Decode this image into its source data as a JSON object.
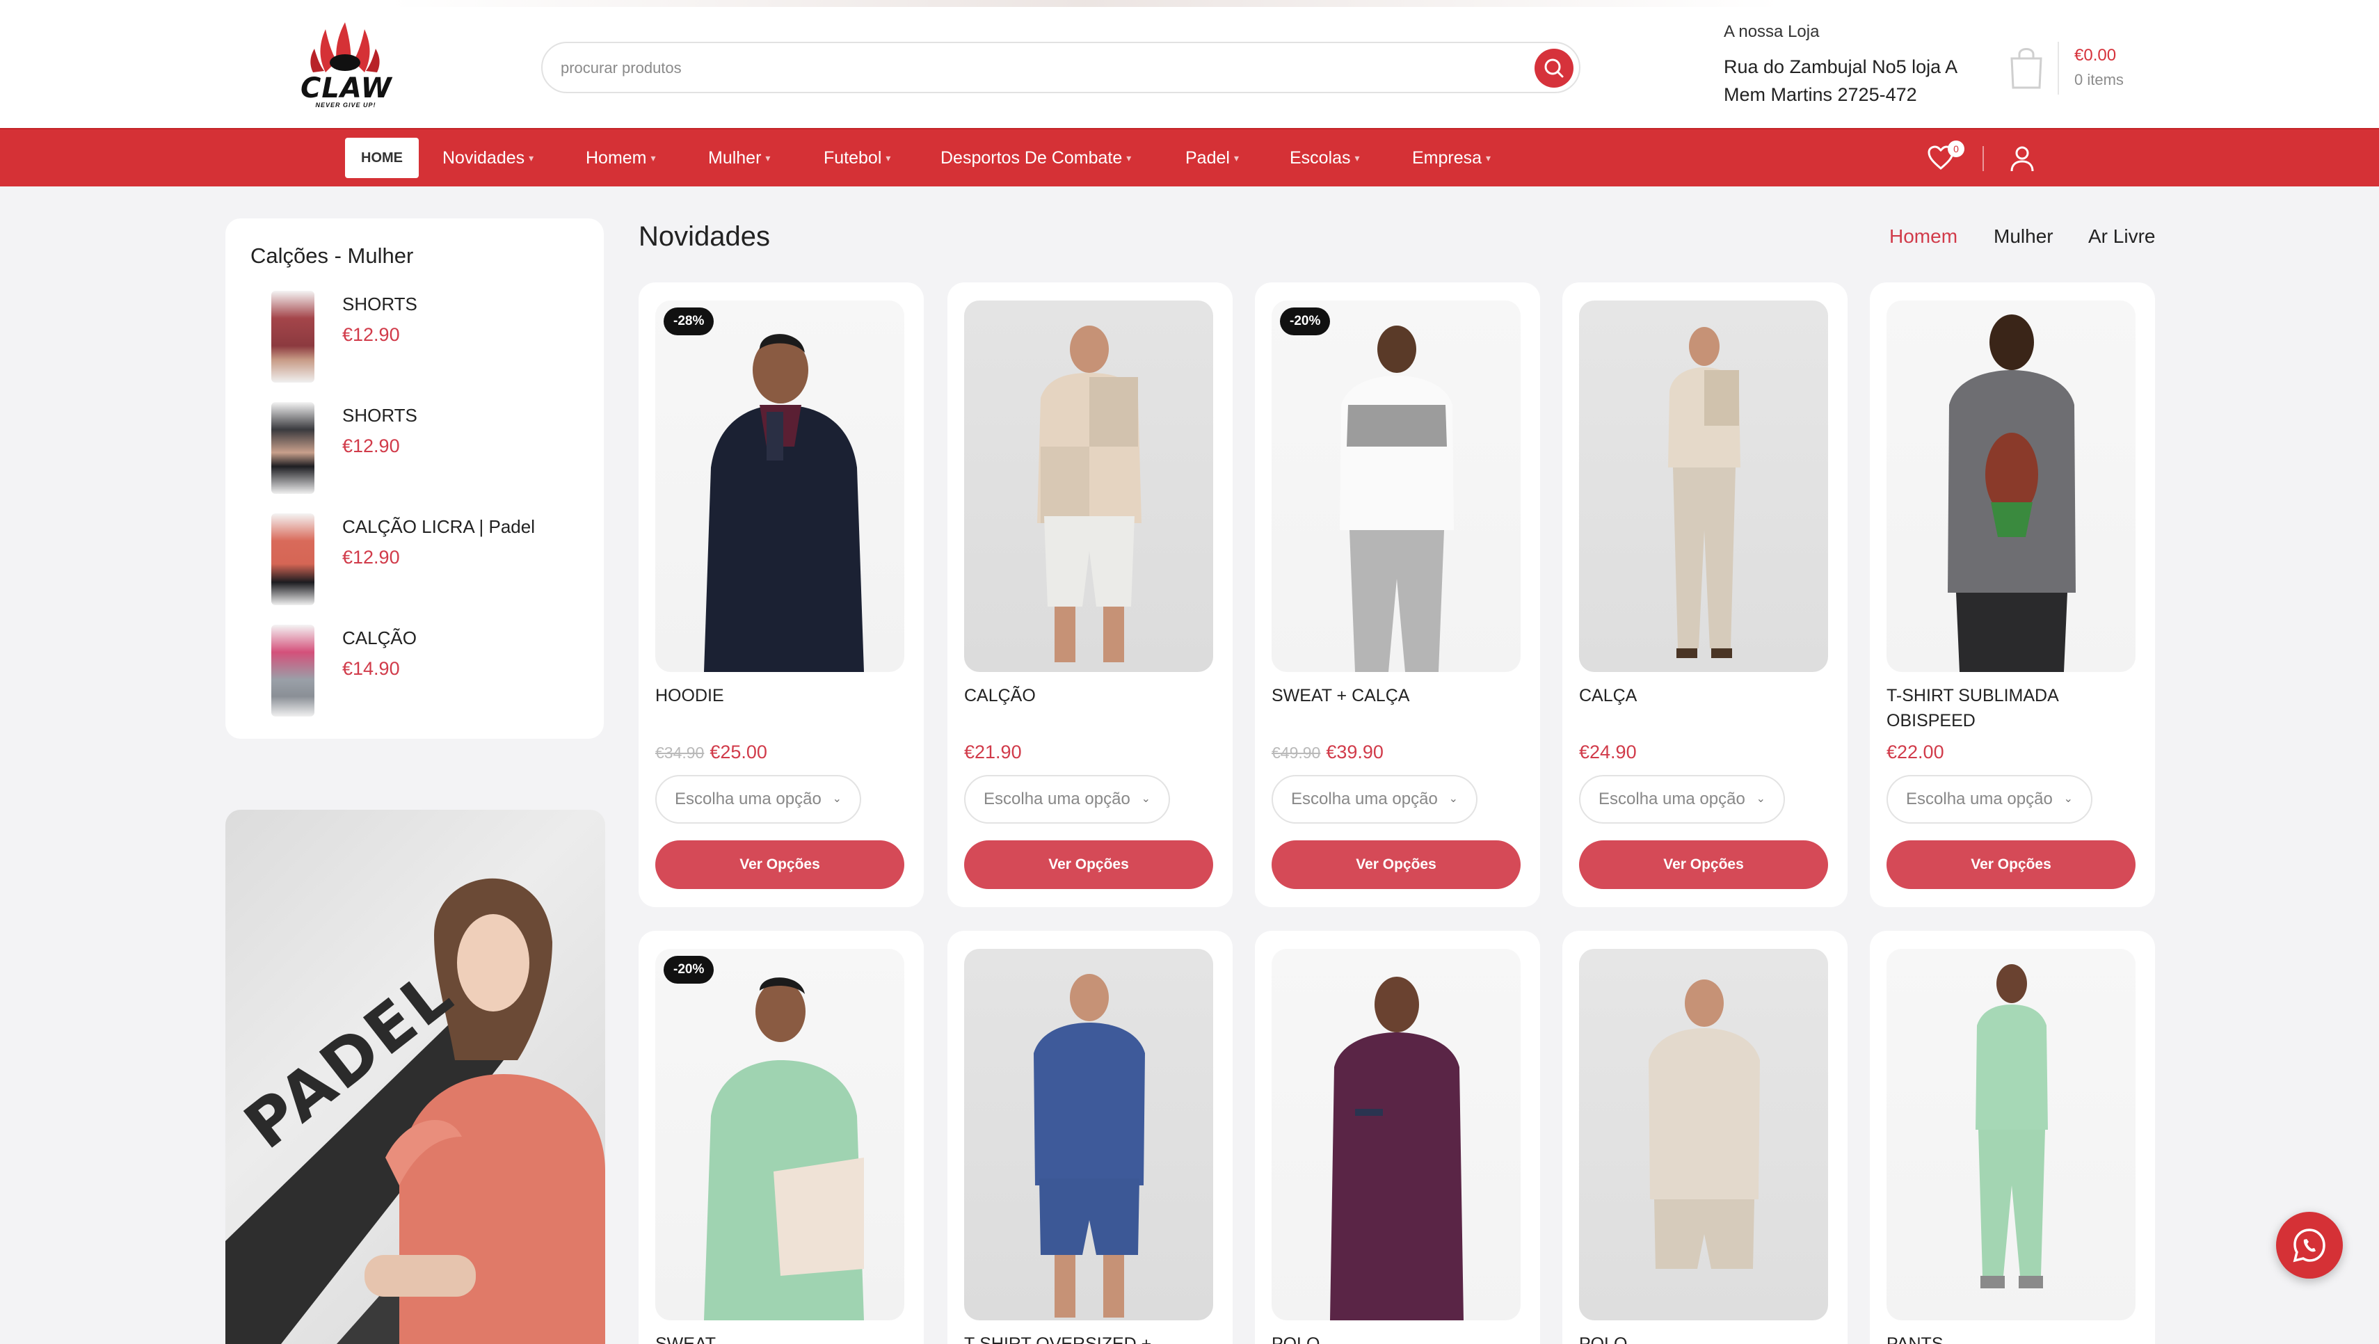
{
  "header": {
    "logo_text": "CLAW",
    "logo_tagline": "NEVER GIVE UP!",
    "search_placeholder": "procurar produtos",
    "store_label": "A nossa Loja",
    "store_address_line1": "Rua do Zambujal No5 loja A",
    "store_address_line2": "Mem Martins 2725-472",
    "cart_total": "€0.00",
    "cart_count": "0 items"
  },
  "nav": {
    "home": "HOME",
    "items": [
      "Novidades",
      "Homem",
      "Mulher",
      "Futebol",
      "Desportos De Combate",
      "Padel",
      "Escolas",
      "Empresa"
    ],
    "wishlist_count": "0"
  },
  "sidebar": {
    "title": "Calções - Mulher",
    "items": [
      {
        "name": "SHORTS",
        "price": "€12.90"
      },
      {
        "name": "SHORTS",
        "price": "€12.90"
      },
      {
        "name": "CALÇÃO LICRA | Padel",
        "price": "€12.90"
      },
      {
        "name": "CALÇÃO",
        "price": "€14.90"
      }
    ],
    "banner_text": "PADEL"
  },
  "main": {
    "title": "Novidades",
    "tabs": [
      "Homem",
      "Mulher",
      "Ar Livre"
    ],
    "select_placeholder": "Escolha uma opção",
    "button_label": "Ver Opções",
    "products_row1": [
      {
        "name": "HOODIE",
        "old_price": "€34.90",
        "price": "€25.00",
        "badge": "-28%"
      },
      {
        "name": "CALÇÃO",
        "old_price": "",
        "price": "€21.90",
        "badge": ""
      },
      {
        "name": "SWEAT + CALÇA",
        "old_price": "€49.90",
        "price": "€39.90",
        "badge": "-20%"
      },
      {
        "name": "CALÇA",
        "old_price": "",
        "price": "€24.90",
        "badge": ""
      },
      {
        "name": "T-SHIRT SUBLIMADA OBISPEED",
        "old_price": "",
        "price": "€22.00",
        "badge": ""
      }
    ],
    "products_row2": [
      {
        "name": "SWEAT",
        "badge": "-20%"
      },
      {
        "name": "T-SHIRT OVERSIZED +",
        "badge": ""
      },
      {
        "name": "POLO",
        "badge": ""
      },
      {
        "name": "POLO",
        "badge": ""
      },
      {
        "name": "PANTS",
        "badge": ""
      }
    ]
  },
  "colors": {
    "brand_red": "#d53136",
    "price_red": "#d13b4a",
    "button_red": "#d54a57"
  }
}
